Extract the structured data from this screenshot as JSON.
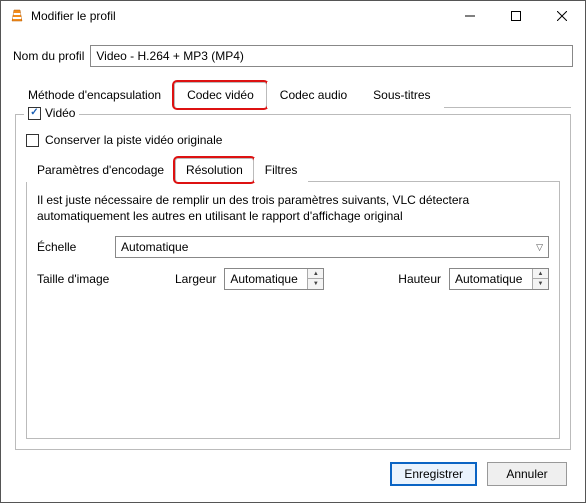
{
  "window": {
    "title": "Modifier le profil"
  },
  "profile": {
    "label": "Nom du profil",
    "value": "Video - H.264 + MP3 (MP4)"
  },
  "tabs": {
    "encapsulation": "Méthode d'encapsulation",
    "video_codec": "Codec vidéo",
    "audio_codec": "Codec audio",
    "subtitles": "Sous-titres"
  },
  "video": {
    "legend": "Vidéo",
    "preserve": "Conserver la piste vidéo originale",
    "subtabs": {
      "encoding": "Paramètres d'encodage",
      "resolution": "Résolution",
      "filters": "Filtres"
    },
    "info": "Il est juste nécessaire de remplir un des trois paramètres suivants, VLC détectera automatiquement les autres en utilisant le rapport d'affichage original",
    "scale": {
      "label": "Échelle",
      "value": "Automatique"
    },
    "framesize": {
      "label": "Taille d'image",
      "width_label": "Largeur",
      "width_value": "Automatique",
      "height_label": "Hauteur",
      "height_value": "Automatique"
    }
  },
  "buttons": {
    "save": "Enregistrer",
    "cancel": "Annuler"
  }
}
